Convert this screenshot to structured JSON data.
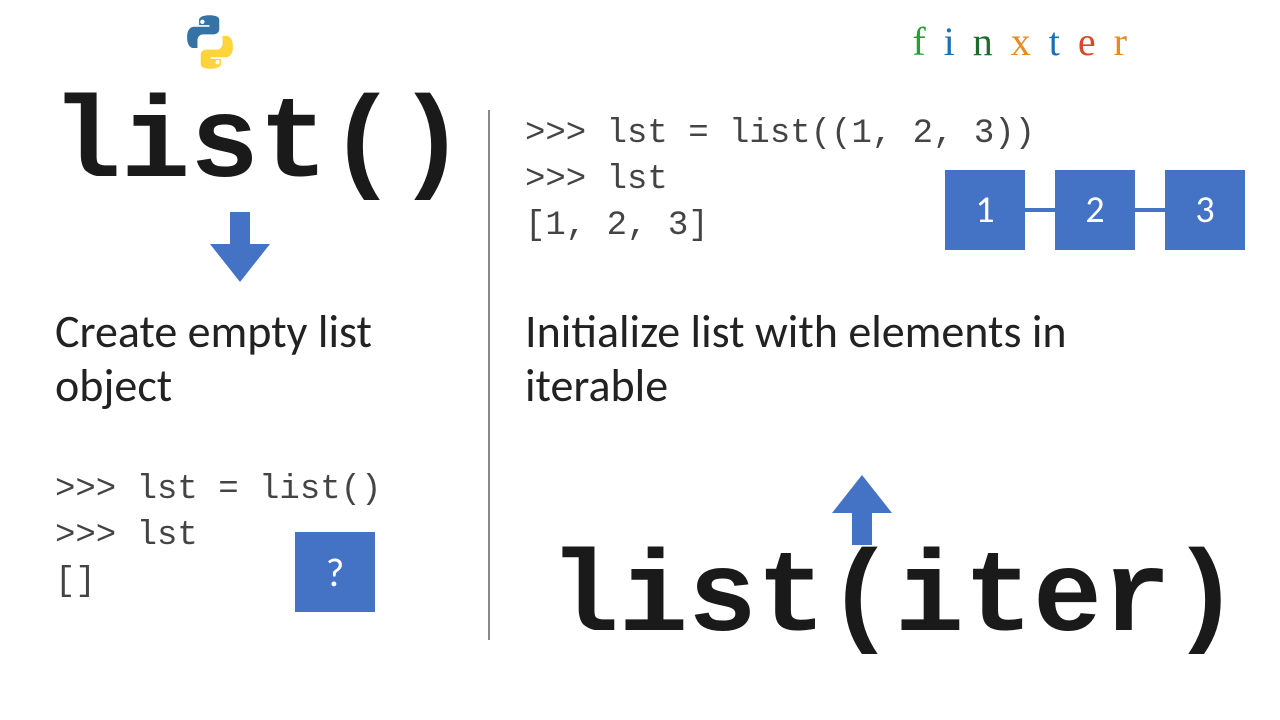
{
  "brand": {
    "letters": [
      "f",
      "i",
      "n",
      "x",
      "t",
      "e",
      "r"
    ]
  },
  "left": {
    "title": "list()",
    "description": "Create empty list object",
    "code": ">>> lst = list()\n>>> lst\n[]",
    "mystery_box": "?"
  },
  "right": {
    "title": "list(iter)",
    "description": "Initialize list with elements in iterable",
    "code": ">>> lst = list((1, 2, 3))\n>>> lst\n[1, 2, 3]",
    "nodes": [
      "1",
      "2",
      "3"
    ]
  },
  "colors": {
    "accent": "#4472c4"
  }
}
